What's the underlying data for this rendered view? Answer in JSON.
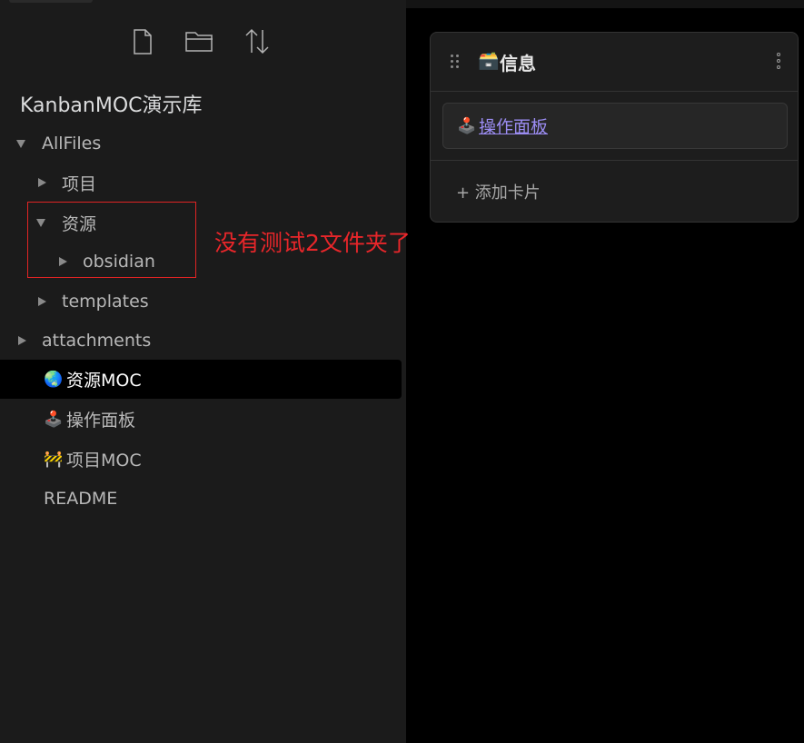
{
  "toolbar": {
    "new_note_icon": "new-note-icon",
    "new_folder_icon": "new-folder-icon",
    "sort_icon": "sort-icon"
  },
  "vault": {
    "name": "KanbanMOC演示库"
  },
  "tree": {
    "allfiles": "AllFiles",
    "xiangmu": "项目",
    "ziyuan": "资源",
    "obsidian": "obsidian",
    "templates": "templates",
    "attachments": "attachments"
  },
  "files": [
    {
      "emoji": "🌏",
      "label": "资源MOC",
      "active": true
    },
    {
      "emoji": "🕹️",
      "label": "操作面板",
      "active": false
    },
    {
      "emoji": "🚧",
      "label": "项目MOC",
      "active": false
    },
    {
      "emoji": "",
      "label": "README",
      "active": false
    }
  ],
  "annotation": {
    "text": "没有测试2文件夹了",
    "color": "#e8262a"
  },
  "board": {
    "column_emoji": "🗃️",
    "column_title": "信息",
    "card_emoji": "🕹️",
    "card_link": "操作面板",
    "add_card": "+ 添加卡片"
  },
  "colors": {
    "sidebar_bg": "#1b1b1b",
    "main_bg": "#000000",
    "link": "#9b8cf2",
    "annotation_red": "#e02424"
  }
}
